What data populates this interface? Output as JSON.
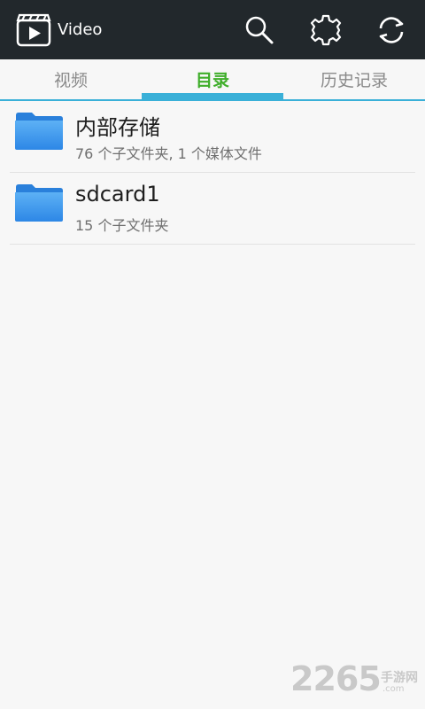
{
  "actionbar": {
    "title": "Video",
    "icons": {
      "app": "clapperboard-play-icon",
      "search": "search-icon",
      "settings": "gear-icon",
      "refresh": "refresh-icon"
    },
    "background": "#22282c"
  },
  "tabs": [
    {
      "label": "视频",
      "selected": false
    },
    {
      "label": "目录",
      "selected": true
    },
    {
      "label": "历史记录",
      "selected": false
    }
  ],
  "accent_color": "#3ab0d8",
  "selected_tab_color": "#3fae2a",
  "folders": [
    {
      "name": "内部存储",
      "detail": "76 个子文件夹, 1 个媒体文件",
      "icon": "folder-icon"
    },
    {
      "name": "sdcard1",
      "detail": "15 个子文件夹",
      "icon": "folder-icon"
    }
  ],
  "watermark": {
    "number": "2265",
    "cn": "手游网",
    "url": ".com"
  }
}
